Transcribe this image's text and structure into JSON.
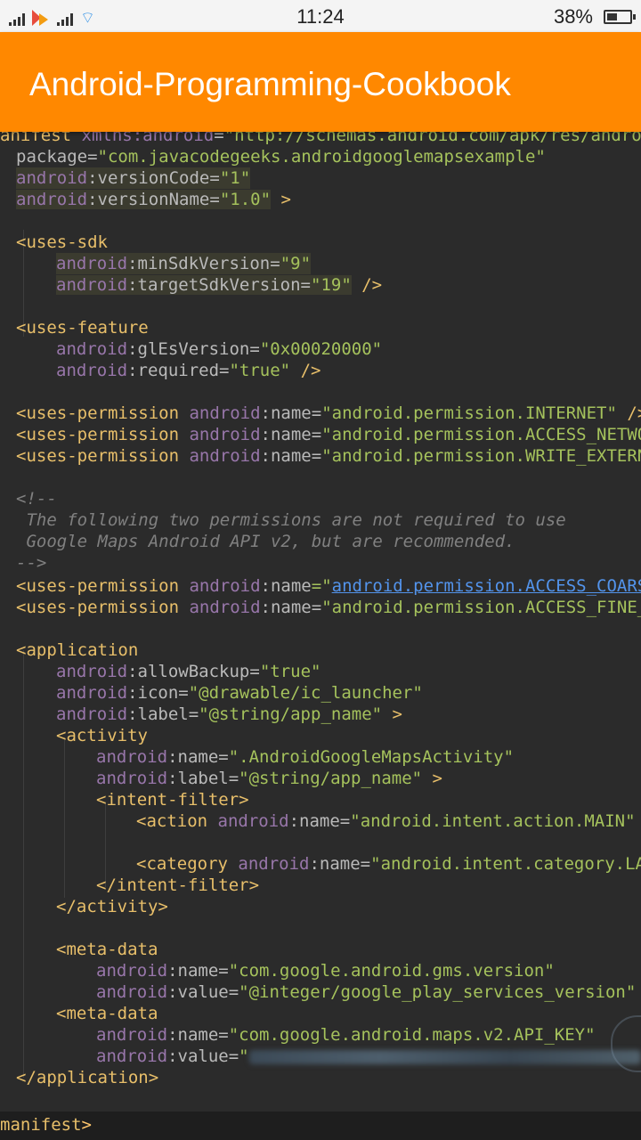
{
  "status_bar": {
    "time": "11:24",
    "battery_percent": "38%"
  },
  "app_bar": {
    "title": "Android-Programming-Cookbook"
  },
  "code": {
    "line0": [
      "anifest ",
      "xmlns:",
      "android",
      "=",
      "\"http://schemas.android.com/apk/res/android\""
    ],
    "line1": [
      "package",
      "=",
      "\"com.javacodegeeks.androidgooglemapsexample\""
    ],
    "line2": [
      "android",
      ":versionCode",
      "=",
      "\"1\""
    ],
    "line3": [
      "android",
      ":versionName",
      "=",
      "\"1.0\"",
      " >"
    ],
    "line5": "<uses-sdk",
    "line6": [
      "android",
      ":minSdkVersion",
      "=",
      "\"9\""
    ],
    "line7": [
      "android",
      ":targetSdkVersion",
      "=",
      "\"19\"",
      " />"
    ],
    "line9": "<uses-feature",
    "line10": [
      "android",
      ":glEsVersion",
      "=",
      "\"0x00020000\""
    ],
    "line11": [
      "android",
      ":required",
      "=",
      "\"true\"",
      " />"
    ],
    "perm1": [
      "<uses-permission ",
      "android",
      ":name",
      "=",
      "\"android.permission.INTERNET\"",
      " />"
    ],
    "perm2": [
      "<uses-permission ",
      "android",
      ":name",
      "=",
      "\"android.permission.ACCESS_NETWOR"
    ],
    "perm3": [
      "<uses-permission ",
      "android",
      ":name",
      "=",
      "\"android.permission.WRITE_EXTERNA"
    ],
    "comment_open": "<!--",
    "comment1": " The following two permissions are not required to use",
    "comment2": " Google Maps Android API v2, but are recommended.",
    "comment_close": "-->",
    "perm4": [
      "<uses-permission ",
      "android",
      ":name",
      "=\"",
      "android.permission.ACCESS_COARSE"
    ],
    "perm5": [
      "<uses-permission ",
      "android",
      ":name",
      "=",
      "\"android.permission.ACCESS_FINE_L"
    ],
    "application": "<application",
    "app_backup": [
      "android",
      ":allowBackup",
      "=",
      "\"true\""
    ],
    "app_icon": [
      "android",
      ":icon",
      "=",
      "\"@drawable/ic_launcher\""
    ],
    "app_label": [
      "android",
      ":label",
      "=",
      "\"@string/app_name\"",
      " >"
    ],
    "activity": "<activity",
    "act_name": [
      "android",
      ":name",
      "=",
      "\".AndroidGoogleMapsActivity\""
    ],
    "act_label": [
      "android",
      ":label",
      "=",
      "\"@string/app_name\"",
      " >"
    ],
    "intent_filter": "<intent-filter>",
    "action": [
      "<action ",
      "android",
      ":name",
      "=",
      "\"android.intent.action.MAIN\"",
      " /"
    ],
    "category": [
      "<category ",
      "android",
      ":name",
      "=",
      "\"android.intent.category.LAU"
    ],
    "intent_filter_close": "</intent-filter>",
    "activity_close": "</activity>",
    "meta1": "<meta-data",
    "meta1_name": [
      "android",
      ":name",
      "=",
      "\"com.google.android.gms.version\""
    ],
    "meta1_value": [
      "android",
      ":value",
      "=",
      "\"@integer/google_play_services_version\"",
      " /"
    ],
    "meta2": "<meta-data",
    "meta2_name": [
      "android",
      ":name",
      "=",
      "\"com.google.android.maps.v2.API_KEY\""
    ],
    "meta2_value": [
      "android",
      ":value",
      "=",
      "\""
    ],
    "application_close": "</application>",
    "manifest_close": [
      "manifest",
      ">"
    ]
  }
}
